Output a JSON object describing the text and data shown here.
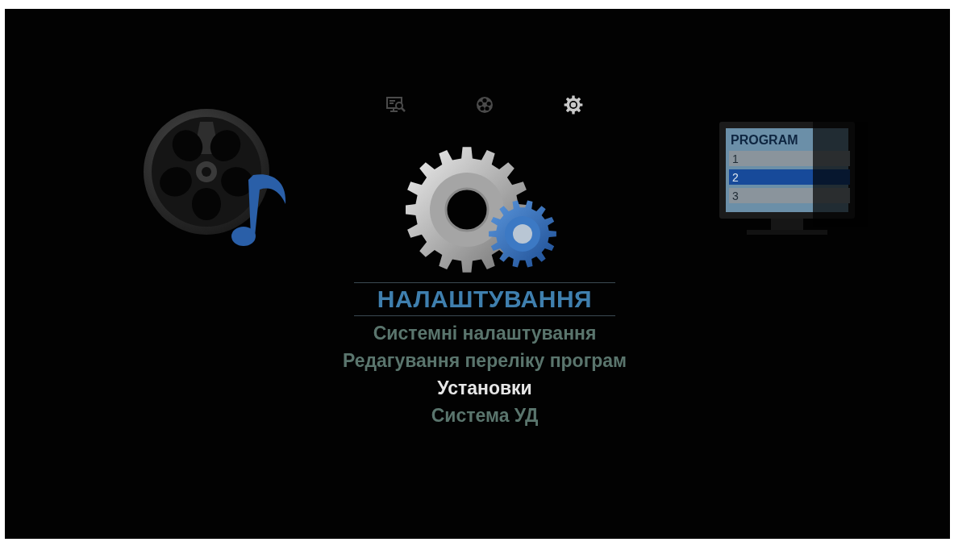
{
  "tabs": [
    {
      "kind": "search",
      "selected": false
    },
    {
      "kind": "media",
      "selected": false
    },
    {
      "kind": "settings",
      "selected": true
    }
  ],
  "carousel": {
    "previous": {
      "kind": "media"
    },
    "current": {
      "kind": "settings"
    },
    "next": {
      "kind": "programs",
      "heading": "PROGRAM",
      "rows": [
        {
          "label": "1",
          "selected": false
        },
        {
          "label": "2",
          "selected": true
        },
        {
          "label": "3",
          "selected": false
        }
      ]
    }
  },
  "menu": {
    "title": "НАЛАШТУВАННЯ",
    "items": [
      {
        "label": "Системні налаштування",
        "selected": false
      },
      {
        "label": "Редагування переліку програм",
        "selected": false
      },
      {
        "label": "Установки",
        "selected": true
      },
      {
        "label": "Система УД",
        "selected": false
      }
    ]
  }
}
